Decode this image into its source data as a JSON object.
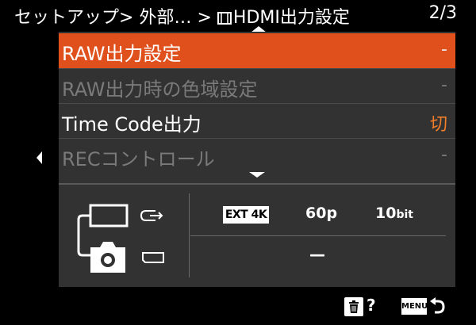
{
  "header": {
    "breadcrumb_prefix": "セットアップ",
    "sep1": ">",
    "section": "外部…",
    "sep2": ">",
    "current": "HDMI出力設定",
    "page": "2/3"
  },
  "menu": {
    "items": [
      {
        "label": "RAW出力設定",
        "value": "-",
        "state": "selected"
      },
      {
        "label": "RAW出力時の色域設定",
        "value": "-",
        "state": "disabled"
      },
      {
        "label": "Time Code出力",
        "value": "切",
        "state": "enabled"
      },
      {
        "label": "RECコントロール",
        "value": "-",
        "state": "disabled"
      }
    ]
  },
  "output_info": {
    "hdmi_ext": "EXT 4K",
    "frame_rate": "60p",
    "bit_depth_num": "10",
    "bit_depth_unit": "bit",
    "card_value": "—"
  },
  "footer": {
    "help_label": "?",
    "menu_key_label": "MENU"
  },
  "colors": {
    "accent_selected": "#e0501d",
    "value_orange": "#ef7d2a",
    "disabled": "#7a7a7a",
    "panel": "#323232"
  }
}
